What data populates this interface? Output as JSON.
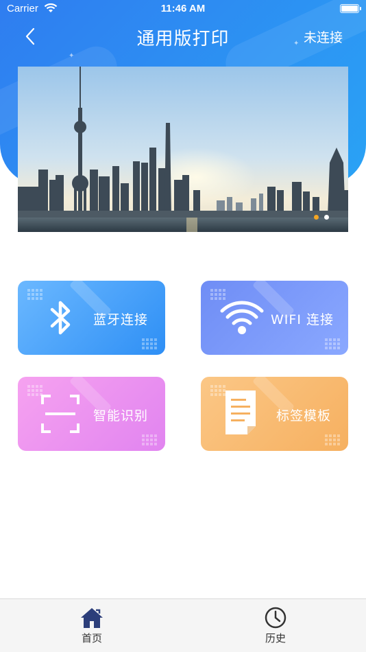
{
  "status_bar": {
    "carrier": "Carrier",
    "time": "11:46 AM"
  },
  "nav": {
    "title": "通用版打印",
    "connection_status": "未连接"
  },
  "banner": {
    "page_count": 2,
    "active_page": 1,
    "dot_active_color": "#f5a623",
    "dot_inactive_color": "#ffffff"
  },
  "features": [
    {
      "label": "蓝牙连接",
      "icon": "bluetooth-icon"
    },
    {
      "label": "WIFI 连接",
      "icon": "wifi-icon"
    },
    {
      "label": "智能识别",
      "icon": "scan-icon"
    },
    {
      "label": "标签模板",
      "icon": "document-icon"
    }
  ],
  "tabbar": {
    "items": [
      {
        "label": "首页",
        "icon": "home-icon"
      },
      {
        "label": "历史",
        "icon": "clock-icon"
      }
    ]
  },
  "colors": {
    "brand_blue": "#2f7df0",
    "home_icon": "#2c3e7a"
  }
}
